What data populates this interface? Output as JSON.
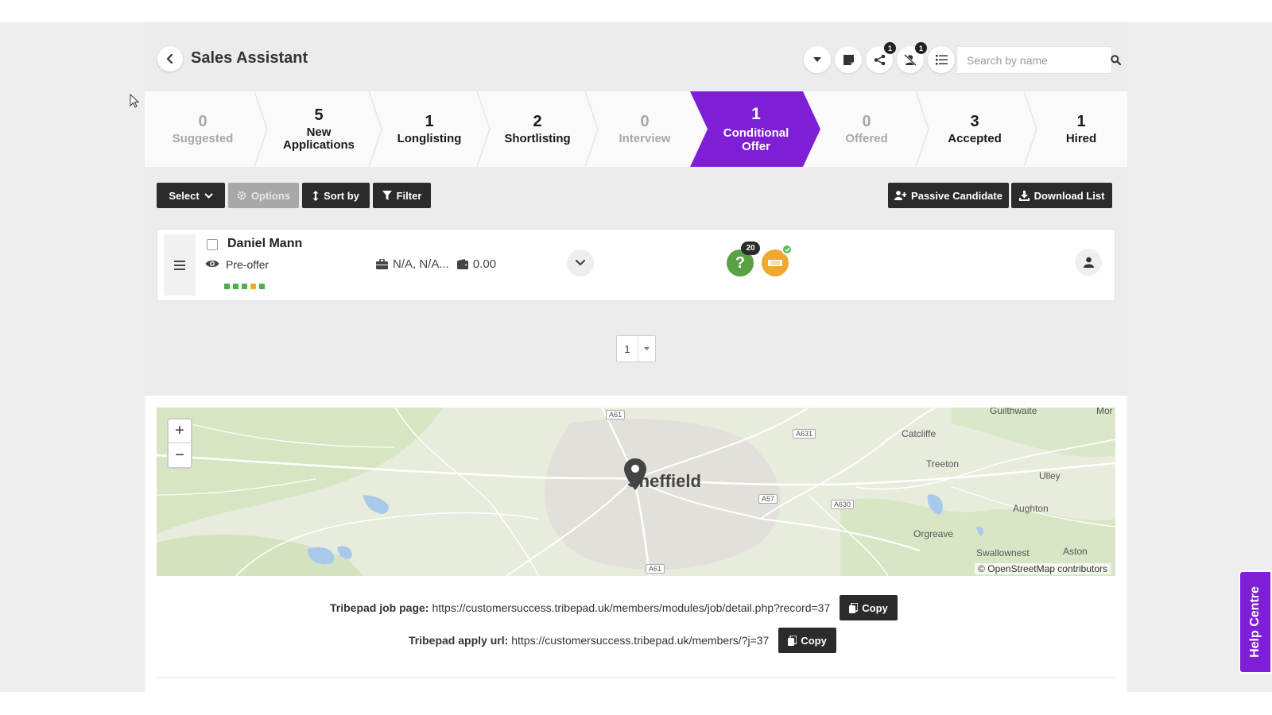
{
  "header": {
    "title": "Sales Assistant",
    "share_badge": "1",
    "reject_badge": "1",
    "search_placeholder": "Search by name"
  },
  "pipeline": [
    {
      "count": "0",
      "label": "Suggested"
    },
    {
      "count": "5",
      "label": "New Applications"
    },
    {
      "count": "1",
      "label": "Longlisting"
    },
    {
      "count": "2",
      "label": "Shortlisting"
    },
    {
      "count": "0",
      "label": "Interview"
    },
    {
      "count": "1",
      "label": "Conditional Offer",
      "active": true
    },
    {
      "count": "0",
      "label": "Offered"
    },
    {
      "count": "3",
      "label": "Accepted"
    },
    {
      "count": "1",
      "label": "Hired"
    }
  ],
  "toolbar": {
    "select": "Select",
    "options": "Options",
    "sort": "Sort by",
    "filter": "Filter",
    "passive": "Passive Candidate",
    "download": "Download List"
  },
  "candidate": {
    "name": "Daniel Mann",
    "status": "Pre-offer",
    "location": "N/A, N/A...",
    "salary": "0.00",
    "questions_badge": "20",
    "score_colors": [
      "#4caf50",
      "#4caf50",
      "#4caf50",
      "#f0a830",
      "#4caf50"
    ]
  },
  "pagination": {
    "page": "1"
  },
  "map": {
    "labels": {
      "sheffield": "Sheffield",
      "catcliffe": "Catcliffe",
      "treeton": "Treeton",
      "ulley": "Ulley",
      "aughton": "Aughton",
      "orgreave": "Orgreave",
      "swallownest": "Swallownest",
      "aston": "Aston",
      "guilthwaite": "Guilthwaite",
      "mor": "Mor"
    },
    "roads": {
      "a61_top": "A61",
      "a631": "A631",
      "a57": "A57",
      "a630": "A630",
      "a61_bottom": "A61"
    },
    "attribution": "© OpenStreetMap contributors"
  },
  "links": {
    "job_label": "Tribepad job page:",
    "job_url": "https://customersuccess.tribepad.uk/members/modules/job/detail.php?record=37",
    "apply_label": "Tribepad apply url:",
    "apply_url": "https://customersuccess.tribepad.uk/members/?j=37",
    "copy": "Copy"
  },
  "help": "Help Centre",
  "colors": {
    "accent": "#7e1fd6",
    "dark_button": "#2b2b2b",
    "green": "#5aa145",
    "orange": "#f0a830"
  }
}
